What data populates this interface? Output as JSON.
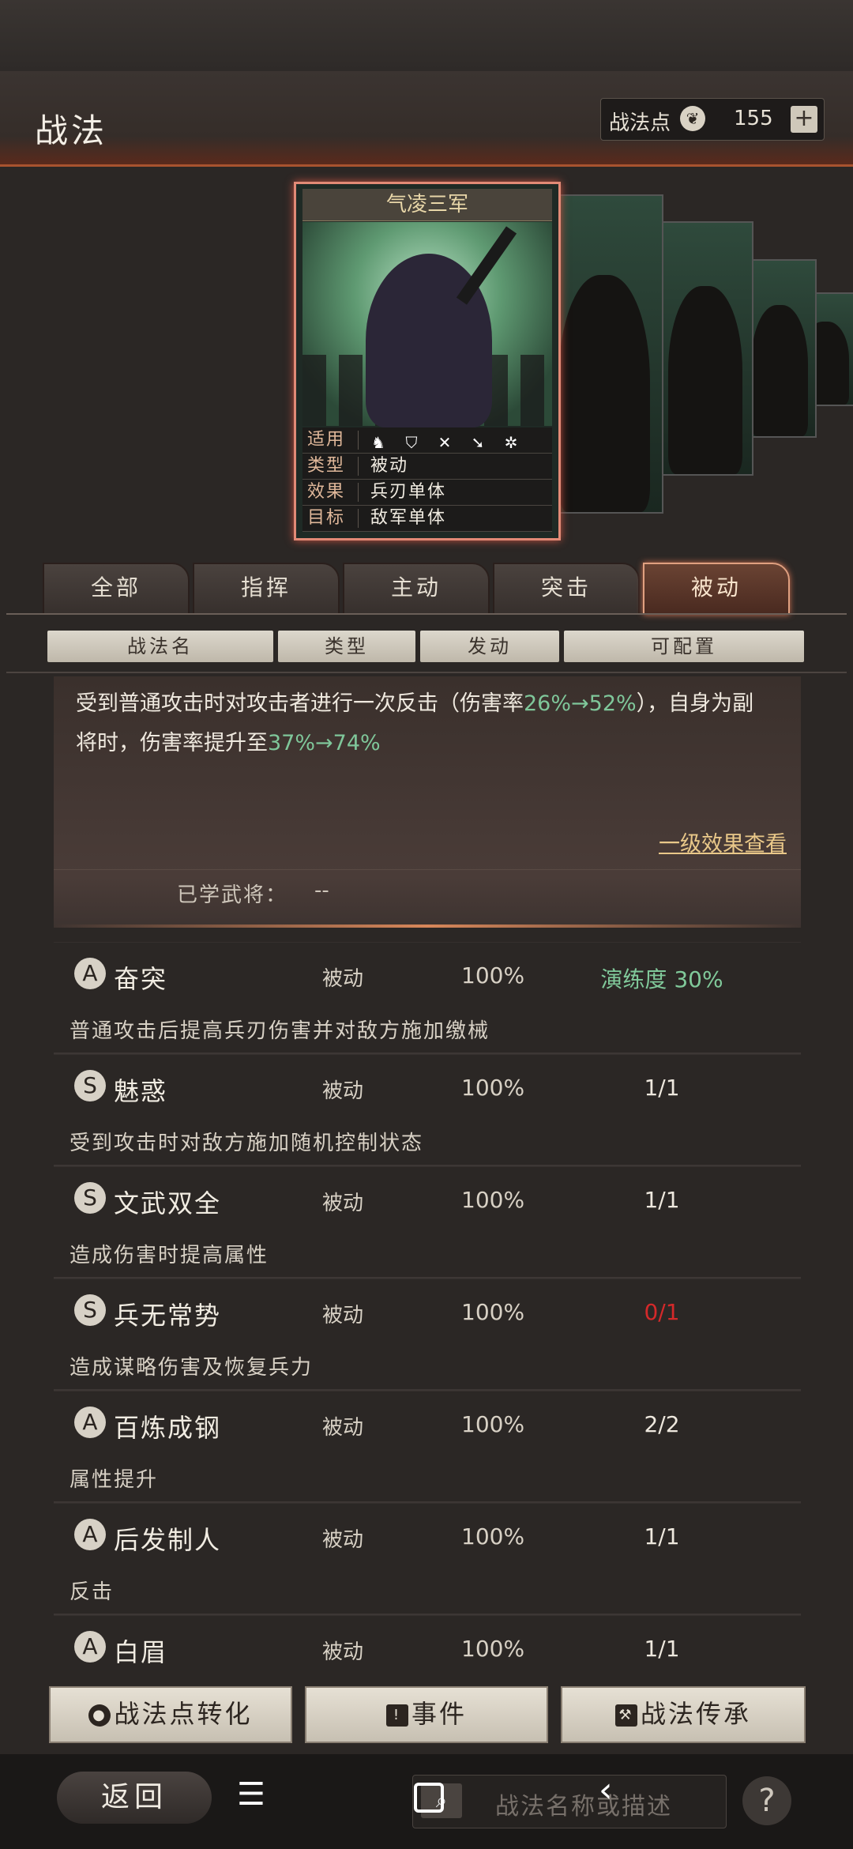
{
  "header": {
    "title": "战法",
    "points_label": "战法点",
    "points_icon": "leaf-coin-icon",
    "points_value": "155",
    "add_label": "+"
  },
  "featured_card": {
    "name": "气凌三军",
    "rows": [
      {
        "key": "适用",
        "value": ""
      },
      {
        "key": "类型",
        "value": "被动"
      },
      {
        "key": "效果",
        "value": "兵刃单体"
      },
      {
        "key": "目标",
        "value": "敌军单体"
      }
    ],
    "unit_icons": [
      "cavalry-icon",
      "shield-icon",
      "bow-icon",
      "spear-icon",
      "wheel-icon"
    ]
  },
  "tabs": [
    "全部",
    "指挥",
    "主动",
    "突击",
    "被动"
  ],
  "active_tab": "被动",
  "columns": [
    "战法名",
    "类型",
    "发动",
    "可配置"
  ],
  "detail": {
    "text_a": "受到普通攻击时对攻击者进行一次反击（伤害率",
    "hl_a": "26%→52%",
    "text_b": "），自身为副将时，伤害率提升至",
    "hl_b": "37%→74%",
    "link": "一级效果查看",
    "learned_label": "已学武将：",
    "learned_value": "--"
  },
  "skills": [
    {
      "grade": "A",
      "name": "奋突",
      "type": "被动",
      "rate": "100%",
      "count": "演练度 30%",
      "count_style": "green",
      "desc": "普通攻击后提高兵刃伤害并对敌方施加缴械"
    },
    {
      "grade": "S",
      "name": "魅惑",
      "type": "被动",
      "rate": "100%",
      "count": "1/1",
      "count_style": "",
      "desc": "受到攻击时对敌方施加随机控制状态"
    },
    {
      "grade": "S",
      "name": "文武双全",
      "type": "被动",
      "rate": "100%",
      "count": "1/1",
      "count_style": "",
      "desc": "造成伤害时提高属性"
    },
    {
      "grade": "S",
      "name": "兵无常势",
      "type": "被动",
      "rate": "100%",
      "count": "0/1",
      "count_style": "red",
      "desc": "造成谋略伤害及恢复兵力"
    },
    {
      "grade": "A",
      "name": "百炼成钢",
      "type": "被动",
      "rate": "100%",
      "count": "2/2",
      "count_style": "",
      "desc": "属性提升"
    },
    {
      "grade": "A",
      "name": "后发制人",
      "type": "被动",
      "rate": "100%",
      "count": "1/1",
      "count_style": "",
      "desc": "反击"
    },
    {
      "grade": "A",
      "name": "白眉",
      "type": "被动",
      "rate": "100%",
      "count": "1/1",
      "count_style": "",
      "desc": ""
    }
  ],
  "buttons": {
    "convert": "战法点转化",
    "events": "事件",
    "inherit": "战法传承"
  },
  "nav": {
    "back": "返回",
    "search_placeholder": "战法名称或描述"
  }
}
